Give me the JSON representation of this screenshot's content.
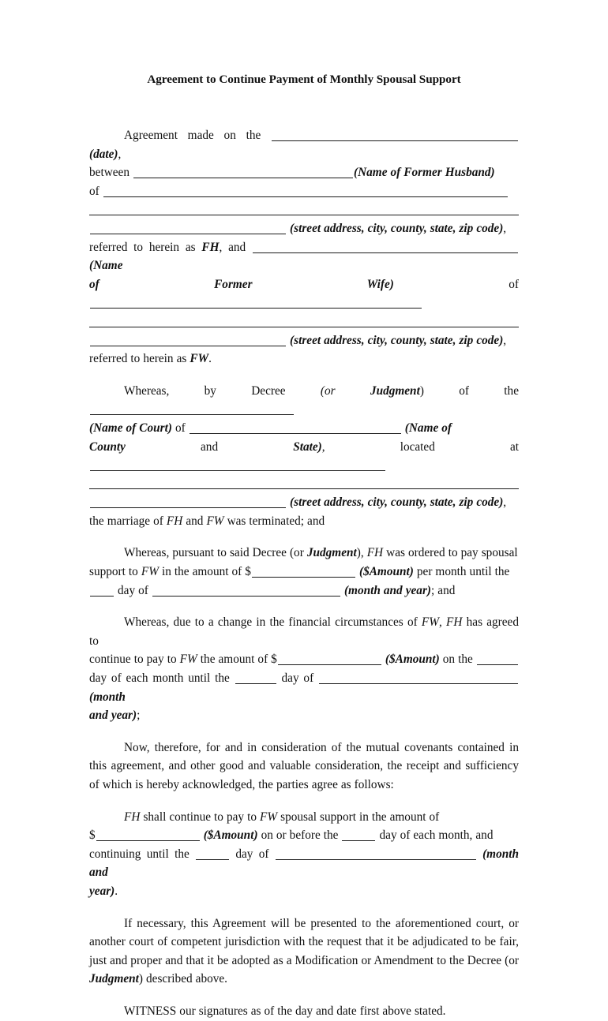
{
  "document": {
    "title": "Agreement to Continue Payment of Monthly Spousal Support",
    "abbreviations": {
      "former_husband": "FH",
      "former_wife": "FW"
    },
    "annotations": {
      "date": "(date)",
      "name_of_former_husband": "(Name of Former Husband)",
      "name_of_former_wife_a": "(Name",
      "name_of_former_wife_b": "of Former Wife)",
      "street_address": "(street address, city, county, state, zip code)",
      "name_of_court": "(Name of Court)",
      "name_of_county_a": "(Name of",
      "name_of_county_b": "County",
      "state": "State)",
      "amount": "($Amount)",
      "month_and_year": "(month and year)",
      "month_and_year_a": "(month",
      "month_and_year_b": "and year)",
      "month_and_year_c": "(month and",
      "month_and_year_d": "year)",
      "judgment": "Judgment"
    },
    "paragraphs": {
      "p1": {
        "s1": "Agreement made on the",
        "s2": ",",
        "s3": "between",
        "s4": "of",
        "s5": ",",
        "s6": "referred to herein as",
        "s7": ", and",
        "s8": "of",
        "s9": ",",
        "s10": "referred to herein as",
        "s11": "."
      },
      "p2": {
        "s1": "Whereas, by Decree",
        "s2": "(or",
        "s3": ") of the",
        "s4": "of",
        "s5": "and",
        "s6": ", located at",
        "s7": ",",
        "s8": "the marriage of",
        "s9": "and",
        "s10": "was terminated; and"
      },
      "p3": {
        "s1": "Whereas, pursuant to said Decree (or",
        "s2": "),",
        "s3": "was ordered to pay spousal",
        "s4": "support to",
        "s5": "in the amount of $",
        "s6": "per month until the",
        "s7": "day of",
        "s8": "; and"
      },
      "p4": {
        "s1": "Whereas, due to a change in the financial circumstances of",
        "s2": ",",
        "s3": "has agreed to",
        "s4": "continue to pay to",
        "s5": "the amount of $",
        "s6": "on the",
        "s7": "day of each month until the",
        "s8": "day of",
        "s9": ";"
      },
      "p5": {
        "s1": "Now, therefore, for and in consideration of the mutual covenants contained in this agreement, and other good and valuable consideration, the receipt and sufficiency of which is hereby acknowledged, the parties agree as follows:"
      },
      "p6": {
        "s1": "shall continue to pay to",
        "s2": "spousal support in the amount of",
        "s3": "$",
        "s4": "on or before the",
        "s5": "day of each month, and",
        "s6": "continuing until the",
        "s7": "day of",
        "s8": "."
      },
      "p7": {
        "s1": "If necessary, this Agreement will be presented to the aforementioned court, or another court of competent jurisdiction with the request that it be adjudicated to be fair, just and proper and that it be adopted as a Modification or Amendment to the Decree (or",
        "s2": ") described above."
      },
      "p8": {
        "s1": "WITNESS our signatures as of the day and date first above stated."
      }
    }
  }
}
